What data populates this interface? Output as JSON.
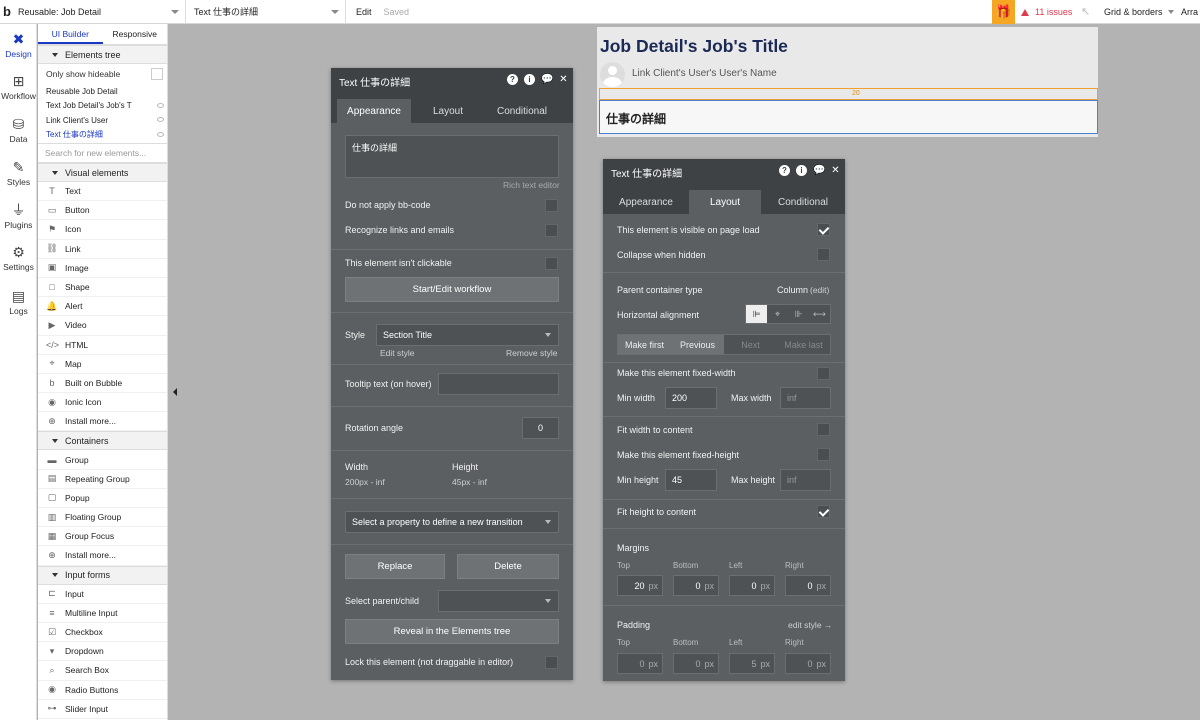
{
  "topbar": {
    "logo": "b",
    "page_select": "Reusable: Job Detail",
    "element_select": "Text 仕事の詳細",
    "edit": "Edit",
    "saved": "Saved",
    "issues": "11 issues",
    "grid_borders": "Grid & borders",
    "arrange": "Arra",
    "issue_color": "#e03a4e",
    "gift_color": "#f5a623"
  },
  "rail": {
    "items": [
      {
        "label": "Design",
        "icon": "design-icon"
      },
      {
        "label": "Workflow",
        "icon": "workflow-icon"
      },
      {
        "label": "Data",
        "icon": "data-icon"
      },
      {
        "label": "Styles",
        "icon": "styles-icon"
      },
      {
        "label": "Plugins",
        "icon": "plugins-icon"
      },
      {
        "label": "Settings",
        "icon": "settings-icon"
      },
      {
        "label": "Logs",
        "icon": "logs-icon"
      }
    ]
  },
  "elements_panel": {
    "tabs": [
      "UI Builder",
      "Responsive"
    ],
    "elements_tree_label": "Elements tree",
    "only_show_hideable": "Only show hideable",
    "tree": [
      "Reusable Job Detail",
      "Text Job Detail's Job's T",
      "Link Client's User",
      "Text 仕事の詳細"
    ],
    "search_placeholder": "Search for new elements...",
    "visual_label": "Visual elements",
    "visual": [
      {
        "label": "Text",
        "icon": "T"
      },
      {
        "label": "Button",
        "icon": "▭"
      },
      {
        "label": "Icon",
        "icon": "⚑"
      },
      {
        "label": "Link",
        "icon": "⛓"
      },
      {
        "label": "Image",
        "icon": "▣"
      },
      {
        "label": "Shape",
        "icon": "□"
      },
      {
        "label": "Alert",
        "icon": "🔔"
      },
      {
        "label": "Video",
        "icon": "▶"
      },
      {
        "label": "HTML",
        "icon": "</>"
      },
      {
        "label": "Map",
        "icon": "⌖"
      },
      {
        "label": "Built on Bubble",
        "icon": "b"
      },
      {
        "label": "Ionic Icon",
        "icon": "◉"
      },
      {
        "label": "Install more...",
        "icon": "⊕"
      }
    ],
    "containers_label": "Containers",
    "containers": [
      {
        "label": "Group",
        "icon": "▬"
      },
      {
        "label": "Repeating Group",
        "icon": "▤"
      },
      {
        "label": "Popup",
        "icon": "▢"
      },
      {
        "label": "Floating Group",
        "icon": "▥"
      },
      {
        "label": "Group Focus",
        "icon": "▦"
      },
      {
        "label": "Install more...",
        "icon": "⊕"
      }
    ],
    "forms_label": "Input forms",
    "forms": [
      {
        "label": "Input",
        "icon": "⊏"
      },
      {
        "label": "Multiline Input",
        "icon": "≡"
      },
      {
        "label": "Checkbox",
        "icon": "☑"
      },
      {
        "label": "Dropdown",
        "icon": "▾"
      },
      {
        "label": "Search Box",
        "icon": "⌕"
      },
      {
        "label": "Radio Buttons",
        "icon": "◉"
      },
      {
        "label": "Slider Input",
        "icon": "⊶"
      }
    ]
  },
  "canvas": {
    "title": "Job Detail's Job's Title",
    "link_text": "Link Client's User's User's Name",
    "margin_value": "20",
    "text_content": "仕事の詳細"
  },
  "appearance_panel": {
    "title": "Text 仕事の詳細",
    "tabs": [
      "Appearance",
      "Layout",
      "Conditional"
    ],
    "text_value": "仕事の詳細",
    "rich_text_editor": "Rich text editor",
    "no_bbcode": "Do not apply bb-code",
    "recognize_links": "Recognize links and emails",
    "not_clickable": "This element isn't clickable",
    "start_workflow": "Start/Edit workflow",
    "style_label": "Style",
    "style_value": "Section Title",
    "edit_style": "Edit style",
    "remove_style": "Remove style",
    "tooltip_label": "Tooltip text (on hover)",
    "rotation_label": "Rotation angle",
    "rotation_value": "0",
    "width_label": "Width",
    "width_value": "200px - inf",
    "height_label": "Height",
    "height_value": "45px - inf",
    "transition_placeholder": "Select a property to define a new transition",
    "replace": "Replace",
    "delete": "Delete",
    "select_parent": "Select parent/child",
    "reveal": "Reveal in the Elements tree",
    "lock": "Lock this element (not draggable in editor)"
  },
  "layout_panel": {
    "title": "Text 仕事の詳細",
    "tabs": [
      "Appearance",
      "Layout",
      "Conditional"
    ],
    "visible_on_load": "This element is visible on page load",
    "collapse_hidden": "Collapse when hidden",
    "parent_type_label": "Parent container type",
    "parent_type_value": "Column",
    "parent_edit": "(edit)",
    "h_align_label": "Horizontal alignment",
    "make_first": "Make first",
    "previous": "Previous",
    "next": "Next",
    "make_last": "Make last",
    "fixed_width": "Make this element fixed-width",
    "min_width_label": "Min width",
    "min_width_value": "200",
    "max_width_label": "Max width",
    "max_width_placeholder": "inf",
    "fit_width": "Fit width to content",
    "fixed_height": "Make this element fixed-height",
    "min_height_label": "Min height",
    "min_height_value": "45",
    "max_height_label": "Max height",
    "max_height_placeholder": "inf",
    "fit_height": "Fit height to content",
    "margins_label": "Margins",
    "padding_label": "Padding",
    "edit_style": "edit style →",
    "side_labels": [
      "Top",
      "Bottom",
      "Left",
      "Right"
    ],
    "margins": [
      "20",
      "0",
      "0",
      "0"
    ],
    "padding": [
      "0",
      "0",
      "5",
      "0"
    ],
    "unit": "px"
  }
}
